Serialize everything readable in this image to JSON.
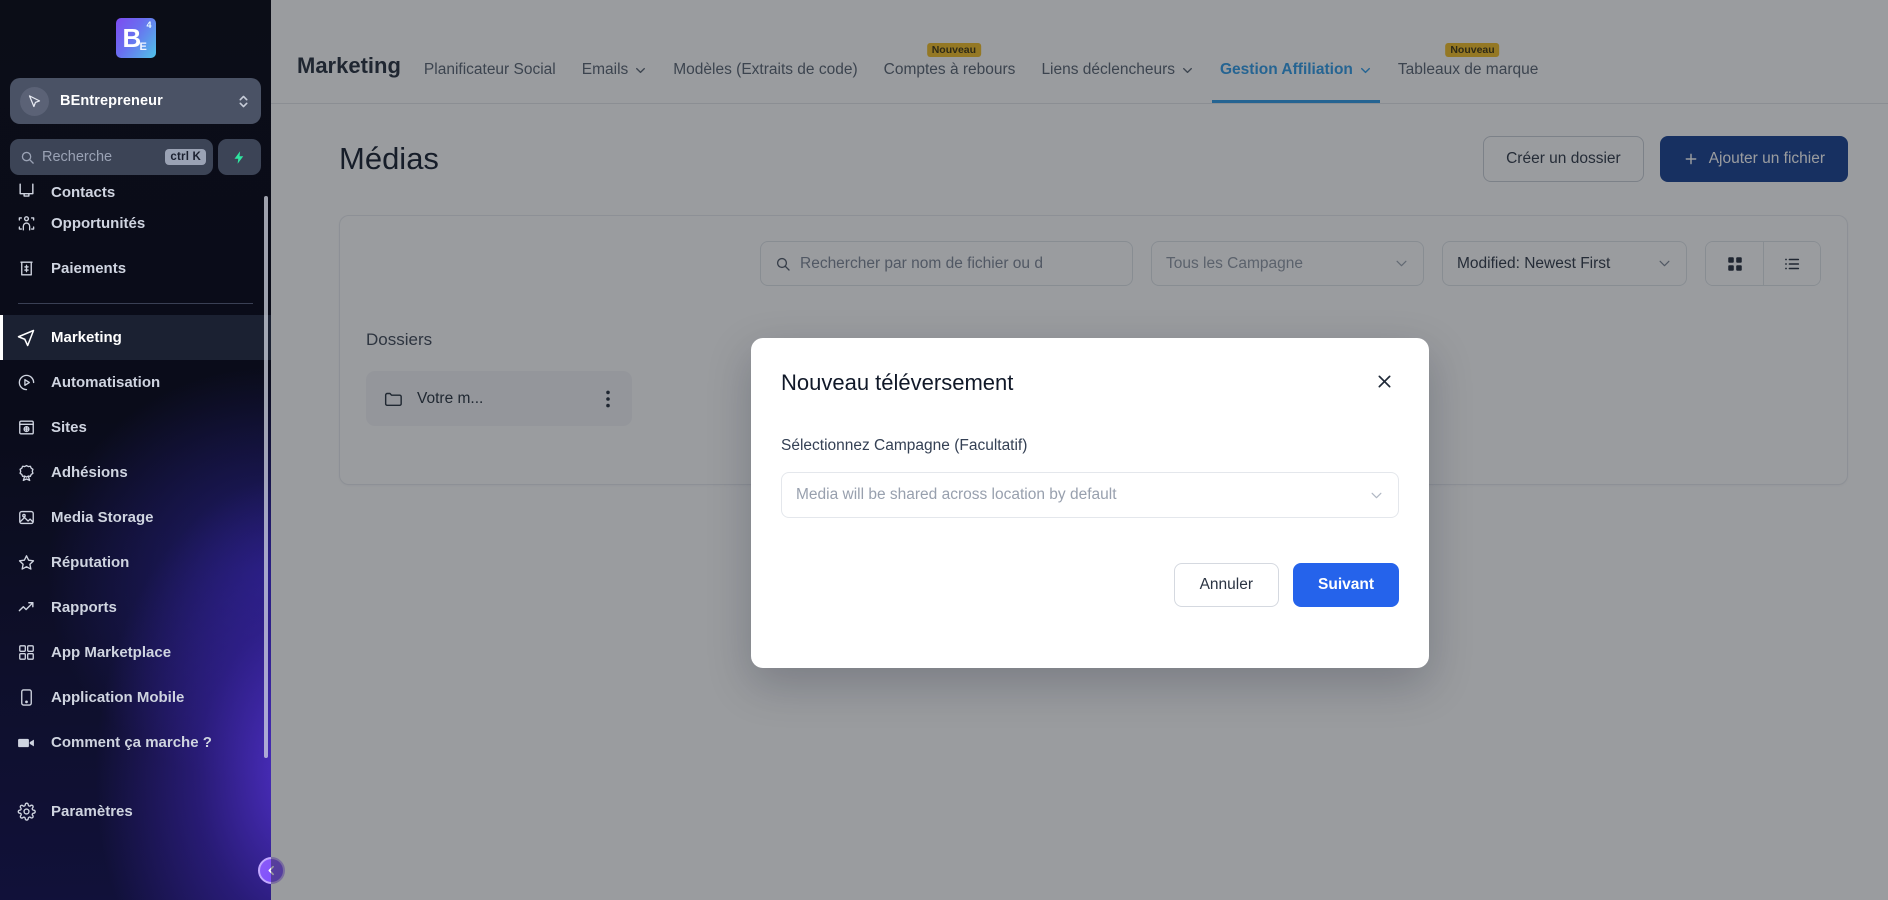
{
  "sidebar": {
    "logo": {
      "letter": "B",
      "sub": "E",
      "sup": "4",
      "name": "logo-b4"
    },
    "account": {
      "name": "BEntrepreneur"
    },
    "search": {
      "placeholder": "Recherche",
      "shortcut": "ctrl K"
    },
    "items": [
      {
        "label": "Contacts",
        "icon": "contacts-icon",
        "state": "clipped"
      },
      {
        "label": "Opportunités",
        "icon": "opportunities-icon",
        "state": "normal"
      },
      {
        "label": "Paiements",
        "icon": "payments-icon",
        "state": "normal"
      },
      {
        "label": "Marketing",
        "icon": "marketing-icon",
        "state": "active"
      },
      {
        "label": "Automatisation",
        "icon": "automation-icon",
        "state": "normal"
      },
      {
        "label": "Sites",
        "icon": "sites-icon",
        "state": "normal"
      },
      {
        "label": "Adhésions",
        "icon": "memberships-icon",
        "state": "normal"
      },
      {
        "label": "Media Storage",
        "icon": "media-storage-icon",
        "state": "normal"
      },
      {
        "label": "Réputation",
        "icon": "reputation-star-icon",
        "state": "normal"
      },
      {
        "label": "Rapports",
        "icon": "reports-trend-icon",
        "state": "normal"
      },
      {
        "label": "App Marketplace",
        "icon": "app-marketplace-icon",
        "state": "normal"
      },
      {
        "label": "Application Mobile",
        "icon": "mobile-app-icon",
        "state": "normal"
      },
      {
        "label": "Comment ça marche ?",
        "icon": "video-camera-icon",
        "state": "normal"
      }
    ],
    "settings": {
      "label": "Paramètres",
      "icon": "gear-icon"
    },
    "collapse": {
      "icon": "chevron-left-icon"
    }
  },
  "topnav": {
    "title": "Marketing",
    "tabs": [
      {
        "label": "Planificateur Social",
        "dropdown": false,
        "badge": null,
        "active": false
      },
      {
        "label": "Emails",
        "dropdown": true,
        "badge": null,
        "active": false
      },
      {
        "label": "Modèles (Extraits de code)",
        "dropdown": false,
        "badge": null,
        "active": false
      },
      {
        "label": "Comptes à rebours",
        "dropdown": false,
        "badge": "Nouveau",
        "active": false
      },
      {
        "label": "Liens déclencheurs",
        "dropdown": true,
        "badge": null,
        "active": false
      },
      {
        "label": "Gestion Affiliation",
        "dropdown": true,
        "badge": null,
        "active": true
      },
      {
        "label": "Tableaux de marque",
        "dropdown": false,
        "badge": "Nouveau",
        "active": false
      }
    ]
  },
  "page": {
    "title": "Médias",
    "create_folder_label": "Créer un dossier",
    "add_file_label": "Ajouter un fichier",
    "toolbar": {
      "search_placeholder": "Rechercher par nom de fichier ou d",
      "campaign_filter": "Tous les Campagne",
      "sort": "Modified: Newest First",
      "view_grid_icon": "grid-view-icon",
      "view_list_icon": "list-view-icon"
    },
    "folders_heading": "Dossiers",
    "folders": [
      {
        "name": "Votre m...",
        "icon": "folder-icon",
        "menu_icon": "kebab-menu-icon"
      }
    ]
  },
  "modal": {
    "title": "Nouveau téléversement",
    "close_icon": "close-icon",
    "field_label": "Sélectionnez Campagne (Facultatif)",
    "select_placeholder": "Media will be shared across location by default",
    "cancel_label": "Annuler",
    "next_label": "Suivant"
  },
  "colors": {
    "primary_blue": "#2563eb",
    "dark_blue": "#113b8f",
    "accent_cyan": "#2b9ae8",
    "badge_yellow": "#f5bd1f",
    "sidebar_dark": "#0b0d17"
  }
}
